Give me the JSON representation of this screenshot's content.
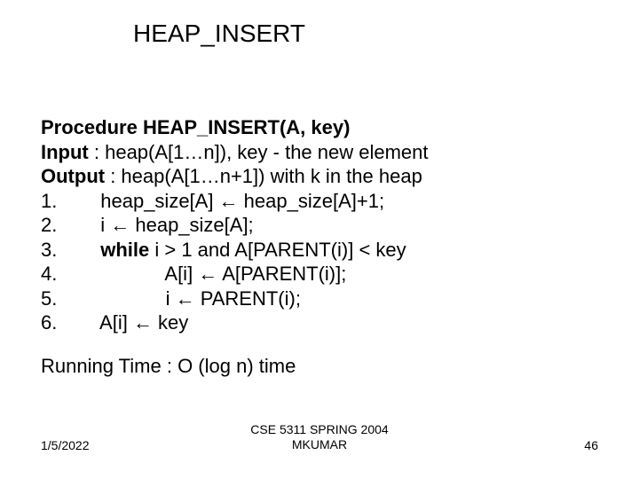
{
  "title": "HEAP_INSERT",
  "proc": {
    "label": "Procedure ",
    "decl": "HEAP_INSERT(A, key)"
  },
  "input": {
    "label": "Input",
    "text": " : heap(A[1…n]), key - the new element"
  },
  "output": {
    "label": "Output",
    "text": " : heap(A[1…n+1]) with k in the heap"
  },
  "steps": [
    {
      "num": "1.        ",
      "pre": "heap_size[A] ← heap_size[A]+1;"
    },
    {
      "num": "2.        ",
      "pre": "i ← heap_size[A];"
    },
    {
      "num": "3.        ",
      "kw": "while",
      "post": " i > 1 and A[PARENT(i)] < key"
    },
    {
      "num": "4.                    ",
      "pre": "A[i] ← A[PARENT(i)];"
    },
    {
      "num": "5.                    ",
      "pre": "i ← PARENT(i);"
    },
    {
      "num": "6.        ",
      "pre": "A[i] ← key"
    }
  ],
  "running": "Running Time : O (log n) time",
  "footer": {
    "date": "1/5/2022",
    "center1": "CSE 5311 SPRING 2004",
    "center2": "MKUMAR",
    "page": "46"
  }
}
